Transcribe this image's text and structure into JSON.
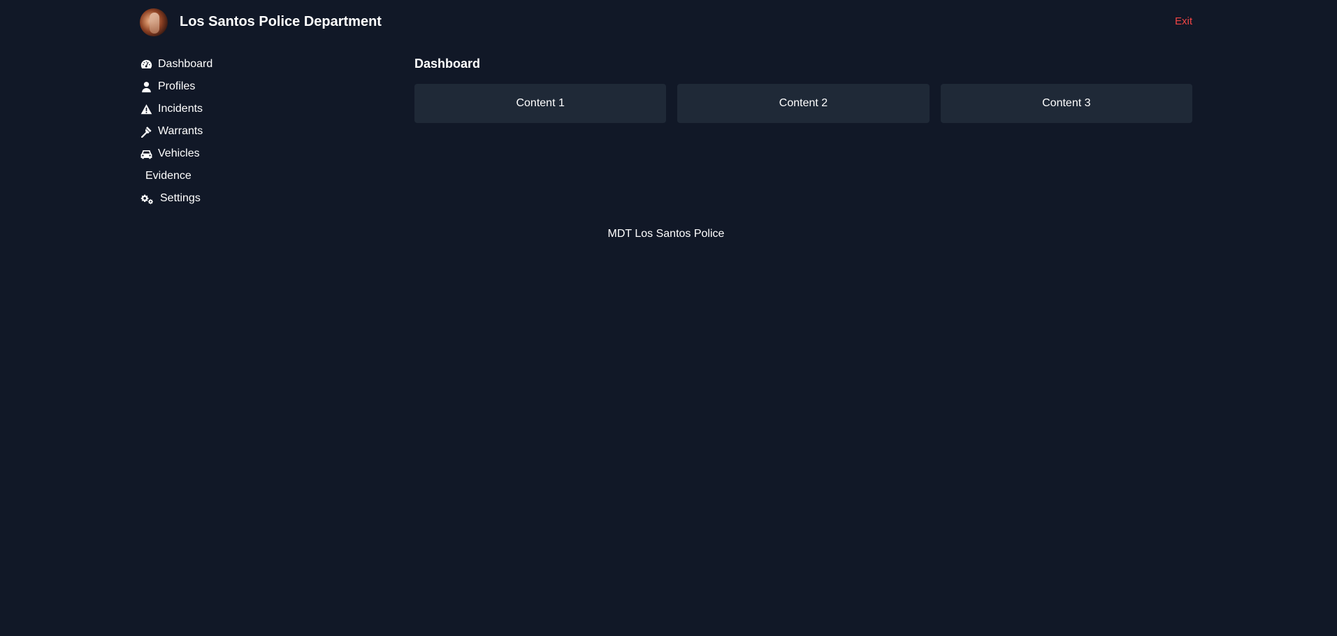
{
  "header": {
    "title": "Los Santos Police Department",
    "exit_label": "Exit"
  },
  "sidebar": {
    "items": [
      {
        "label": "Dashboard",
        "icon": "tachometer-icon"
      },
      {
        "label": "Profiles",
        "icon": "user-icon"
      },
      {
        "label": "Incidents",
        "icon": "warning-icon"
      },
      {
        "label": "Warrants",
        "icon": "gavel-icon"
      },
      {
        "label": "Vehicles",
        "icon": "car-icon"
      },
      {
        "label": "Evidence",
        "icon": ""
      },
      {
        "label": "Settings",
        "icon": "cogs-icon"
      }
    ]
  },
  "main": {
    "title": "Dashboard",
    "cards": [
      {
        "label": "Content 1"
      },
      {
        "label": "Content 2"
      },
      {
        "label": "Content 3"
      }
    ]
  },
  "footer": {
    "text": "MDT Los Santos Police"
  },
  "colors": {
    "background": "#111827",
    "card": "#1f2937",
    "exit": "#ef4444",
    "text": "#ffffff"
  }
}
